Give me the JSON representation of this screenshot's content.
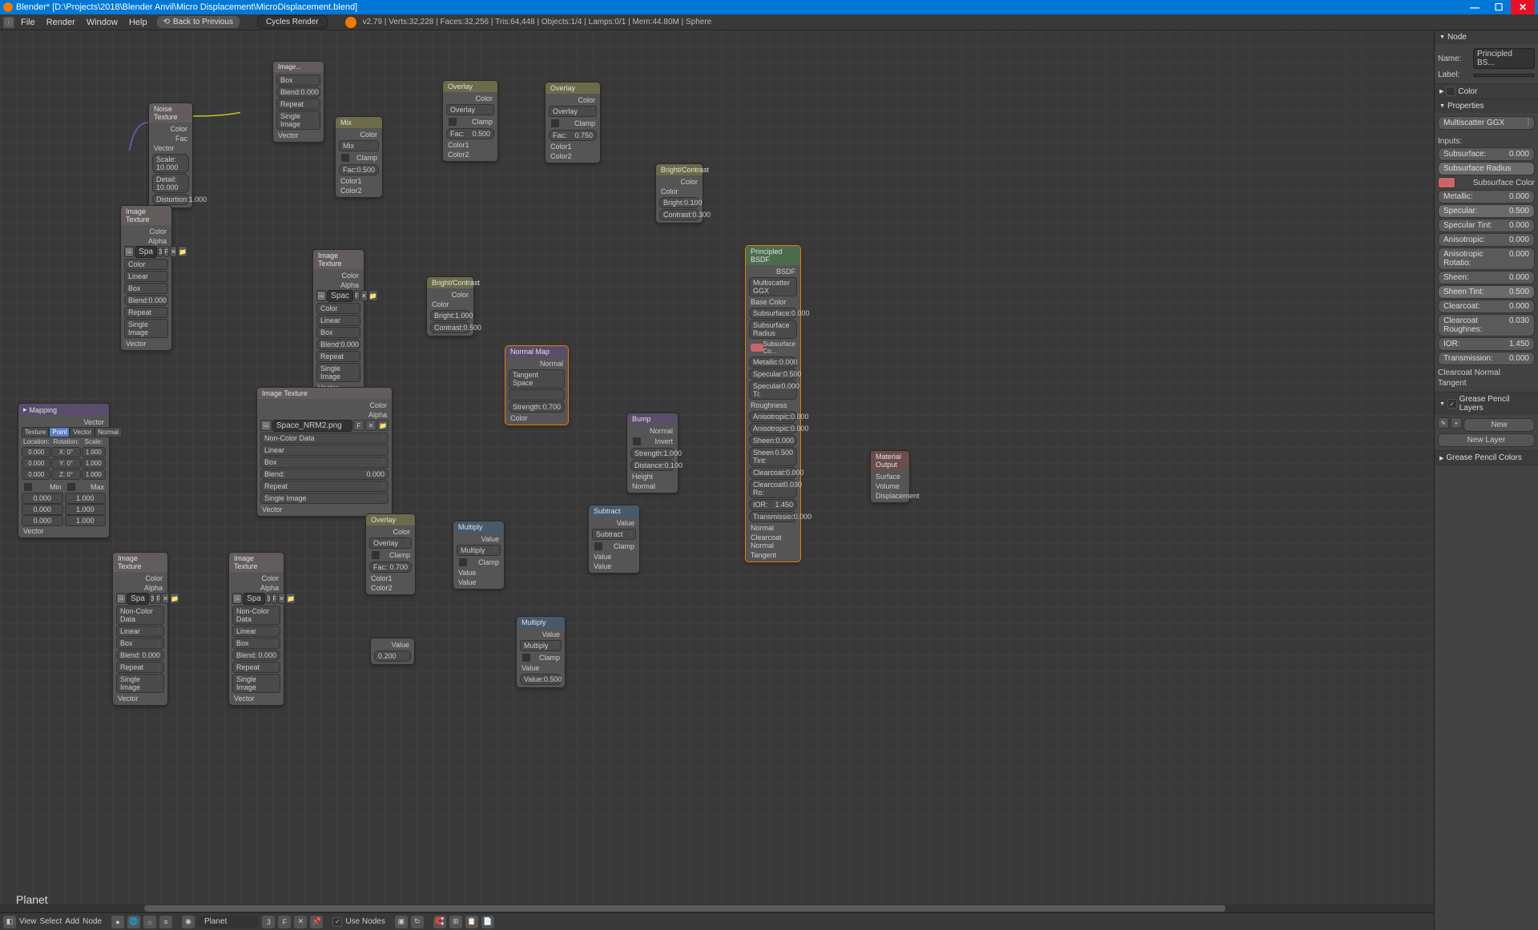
{
  "window": {
    "title": "Blender* [D:\\Projects\\2018\\Blender Anvil\\Micro Displacement\\MicroDisplacement.blend]"
  },
  "menubar": {
    "items": [
      "File",
      "Render",
      "Window",
      "Help"
    ],
    "back": "Back to Previous",
    "render_engine": "Cycles Render",
    "stats": "v2.79 | Verts:32,228 | Faces:32,256 | Tris:64,448 | Objects:1/4 | Lamps:0/1 | Mem:44.80M | Sphere"
  },
  "editor": {
    "material_name": "Planet",
    "material_users": "3",
    "use_nodes": "Use Nodes"
  },
  "footer": {
    "items": [
      "View",
      "Select",
      "Add",
      "Node"
    ]
  },
  "sidebar": {
    "node_panel": "Node",
    "name_lbl": "Name:",
    "name_val": "Principled BS...",
    "label_lbl": "Label:",
    "label_val": "",
    "color_panel": "Color",
    "props_panel": "Properties",
    "distribution": "Multiscatter GGX",
    "inputs_lbl": "Inputs:",
    "props": [
      {
        "label": "Subsurface:",
        "val": "0.000"
      },
      {
        "label": "Subsurface Radius",
        "val": "",
        "hl": true
      },
      {
        "label": "Subsurface Color",
        "val": "",
        "color": true
      },
      {
        "label": "Metallic:",
        "val": "0.000"
      },
      {
        "label": "Specular:",
        "val": "0.500",
        "hl": true
      },
      {
        "label": "Specular Tint:",
        "val": "0.000"
      },
      {
        "label": "Anisotropic:",
        "val": "0.000"
      },
      {
        "label": "Anisotropic Rotatio:",
        "val": "0.000"
      },
      {
        "label": "Sheen:",
        "val": "0.000"
      },
      {
        "label": "Sheen Tint:",
        "val": "0.500",
        "hl": true
      },
      {
        "label": "Clearcoat:",
        "val": "0.000"
      },
      {
        "label": "Clearcoat Roughnes:",
        "val": "0.030"
      },
      {
        "label": "IOR:",
        "val": "1.450"
      },
      {
        "label": "Transmission:",
        "val": "0.000"
      }
    ],
    "clearcoat_normal": "Clearcoat Normal",
    "tangent": "Tangent",
    "gp_layers": "Grease Pencil Layers",
    "gp_new": "New",
    "gp_newlayer": "New Layer",
    "gp_colors": "Grease Pencil Colors"
  },
  "nodes": {
    "mapping": {
      "title": "Mapping",
      "out": "Vector",
      "tabs": [
        "Texture",
        "Point",
        "Vector",
        "Normal"
      ],
      "hdrs": [
        "Location:",
        "Rotation:",
        "Scale:"
      ],
      "loc": [
        "0.000",
        "0.000",
        "0.000"
      ],
      "rot": [
        "X: 0°",
        "Y: 0°",
        "Z: 0°"
      ],
      "scl": [
        "1.000",
        "1.000",
        "1.000"
      ],
      "min_lbl": "Min",
      "max_lbl": "Max",
      "min": [
        "0.000",
        "0.000",
        "0.000"
      ],
      "max": [
        "1.000",
        "1.000",
        "1.000"
      ],
      "vec_in": "Vector"
    },
    "noise": {
      "title": "Noise Texture",
      "outs": [
        "Color",
        "Fac"
      ],
      "in": "Vector",
      "scale": "Scale:  10.000",
      "detail": "Detail:  10.000",
      "dist": "Distortion:1.000"
    },
    "imgtex1": {
      "title": "Image Texture",
      "outs": [
        "Color",
        "Alpha"
      ],
      "img": "Spa",
      "color": "Color",
      "interp": "Linear",
      "proj": "Box",
      "blend_l": "Blend:",
      "blend_v": "0.000",
      "ext": "Repeat",
      "src": "Single Image",
      "vec": "Vector"
    },
    "imgtex2": {
      "title": "Image Texture",
      "outs": [
        "Color",
        "Alpha"
      ],
      "img": "Spac",
      "color": "Color",
      "interp": "Linear",
      "proj": "Box",
      "blend_l": "Blend:",
      "blend_v": "0.000",
      "ext": "Repeat",
      "src": "Single Image",
      "vec": "Vector"
    },
    "imgtex3": {
      "title": "Image Texture",
      "outs": [
        "Color",
        "Alpha"
      ],
      "img": "Space_NRM2.png",
      "color": "Non-Color Data",
      "interp": "Linear",
      "proj": "Box",
      "blend_l": "Blend:",
      "blend_v": "0.000",
      "ext": "Repeat",
      "src": "Single Image",
      "vec": "Vector"
    },
    "imgtex4": {
      "title": "Image Texture",
      "outs": [
        "Color",
        "Alpha"
      ],
      "img": "Spa",
      "color": "Non-Color Data",
      "interp": "Linear",
      "proj": "Box",
      "blend_l": "Blend:",
      "blend_v": "0.000",
      "ext": "Repeat",
      "src": "Single Image",
      "vec": "Vector"
    },
    "imgtex5": {
      "title": "Image Texture",
      "outs": [
        "Color",
        "Alpha"
      ],
      "img": "Spa",
      "color": "Non-Color Data",
      "interp": "Linear",
      "proj": "Box",
      "blend_l": "Blend:",
      "blend_v": "0.000",
      "ext": "Repeat",
      "src": "Single Image",
      "vec": "Vector"
    },
    "mix1": {
      "title": "Mix",
      "out": "Color",
      "mode": "Mix",
      "clamp": "Clamp",
      "fac_l": "Fac:",
      "fac_v": "0.500",
      "c1": "Color1",
      "c2": "Color2"
    },
    "overlay1": {
      "title": "Overlay",
      "out": "Color",
      "mode": "Overlay",
      "clamp": "Clamp",
      "fac_l": "Fac:",
      "fac_v": "0.500",
      "c1": "Color1",
      "c2": "Color2"
    },
    "overlay2": {
      "title": "Overlay",
      "out": "Color",
      "mode": "Overlay",
      "clamp": "Clamp",
      "fac_l": "Fac:",
      "fac_v": "0.750",
      "c1": "Color1",
      "c2": "Color2"
    },
    "overlay3": {
      "title": "Overlay",
      "out": "Color",
      "mode": "Overlay",
      "clamp": "Clamp",
      "fac_l": "Fac:",
      "fac_v": "0.700",
      "c1": "Color1",
      "c2": "Color2"
    },
    "bc1": {
      "title": "Bright/Contrast",
      "out": "Color",
      "in": "Color",
      "b_l": "Bright:",
      "b_v": "1.000",
      "c_l": "Contrast:",
      "c_v": "0.500"
    },
    "bc2": {
      "title": "Bright/Contrast",
      "out": "Color",
      "in": "Color",
      "b_l": "Bright:",
      "b_v": "0.100",
      "c_l": "Contrast:",
      "c_v": "0.300"
    },
    "normalmap": {
      "title": "Normal Map",
      "out": "Normal",
      "space": "Tangent Space",
      "uv": "",
      "str_l": "Strength:",
      "str_v": "0.700",
      "color": "Color"
    },
    "bump": {
      "title": "Bump",
      "out": "Normal",
      "invert": "Invert",
      "str_l": "Strength:",
      "str_v": "1.000",
      "dist_l": "Distance:",
      "dist_v": "0.100",
      "h": "Height",
      "n": "Normal"
    },
    "multiply1": {
      "title": "Multiply",
      "out": "Value",
      "mode": "Multiply",
      "clamp": "Clamp",
      "v1": "Value",
      "v2": "Value"
    },
    "multiply2": {
      "title": "Multiply",
      "out": "Value",
      "mode": "Multiply",
      "clamp": "Clamp",
      "v1": "Value",
      "v2_l": "Value:",
      "v2_v": "0.500"
    },
    "subtract": {
      "title": "Subtract",
      "out": "Value",
      "mode": "Subtract",
      "clamp": "Clamp",
      "v1": "Value",
      "v2": "Value"
    },
    "value": {
      "title": "Value",
      "out": "Value",
      "val": "0.200"
    },
    "principled": {
      "title": "Principled BSDF",
      "out": "BSDF",
      "dist": "Multiscatter GGX",
      "base": "Base Color",
      "props": [
        {
          "l": "Subsurface:",
          "v": "0.000"
        },
        {
          "l": "Subsurface Radius",
          "v": ""
        },
        {
          "l": "Subsurface Co...",
          "v": "",
          "color": true
        },
        {
          "l": "Metallic:",
          "v": "0.000"
        },
        {
          "l": "Specular:",
          "v": "0.500"
        },
        {
          "l": "Specular Ti:",
          "v": "0.000"
        },
        {
          "l": "Roughness",
          "v": ""
        },
        {
          "l": "Anisotropic:",
          "v": "0.000"
        },
        {
          "l": "Anisotropic:",
          "v": "0.000"
        },
        {
          "l": "Sheen:",
          "v": "0.000"
        },
        {
          "l": "Sheen Tint:",
          "v": "0.500"
        },
        {
          "l": "Clearcoat:",
          "v": "0.000"
        },
        {
          "l": "Clearcoat Ro:",
          "v": "0.030"
        },
        {
          "l": "IOR:",
          "v": "1.450"
        },
        {
          "l": "Transmissio:",
          "v": "0.000"
        }
      ],
      "normal": "Normal",
      "cnormal": "Clearcoat Normal",
      "tangent": "Tangent"
    },
    "matout": {
      "title": "Material Output",
      "s": "Surface",
      "v": "Volume",
      "d": "Displacement"
    }
  }
}
